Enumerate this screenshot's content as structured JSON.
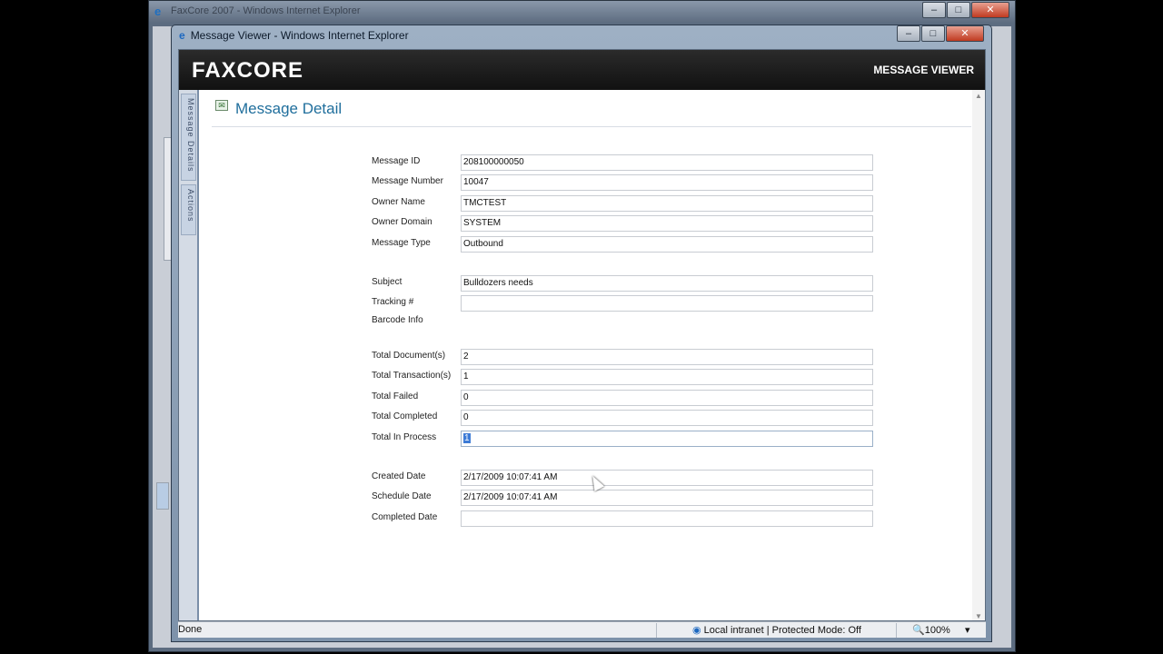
{
  "back_window": {
    "title": "FaxCore 2007 - Windows Internet Explorer"
  },
  "window": {
    "title": "Message Viewer - Windows Internet Explorer",
    "buttons": {
      "minimize": "–",
      "maximize": "□",
      "close": "✕"
    }
  },
  "header": {
    "logo": "FAXCORE",
    "section": "MESSAGE VIEWER"
  },
  "side_tabs": [
    "Message Details",
    "Actions"
  ],
  "detail": {
    "title": "Message Detail"
  },
  "fields": {
    "message_id": {
      "label": "Message ID",
      "value": "208100000050"
    },
    "message_number": {
      "label": "Message Number",
      "value": "10047"
    },
    "owner_name": {
      "label": "Owner Name",
      "value": "TMCTEST"
    },
    "owner_domain": {
      "label": "Owner Domain",
      "value": "SYSTEM"
    },
    "message_type": {
      "label": "Message Type",
      "value": "Outbound"
    },
    "subject": {
      "label": "Subject",
      "value": "Bulldozers needs"
    },
    "tracking": {
      "label": "Tracking #",
      "value": ""
    },
    "barcode": {
      "label": "Barcode Info"
    },
    "total_documents": {
      "label": "Total Document(s)",
      "value": "2"
    },
    "total_transactions": {
      "label": "Total Transaction(s)",
      "value": "1"
    },
    "total_failed": {
      "label": "Total Failed",
      "value": "0"
    },
    "total_completed": {
      "label": "Total Completed",
      "value": "0"
    },
    "total_in_process": {
      "label": "Total In Process",
      "value": "1"
    },
    "created_date": {
      "label": "Created Date",
      "value": "2/17/2009 10:07:41 AM"
    },
    "schedule_date": {
      "label": "Schedule Date",
      "value": "2/17/2009 10:07:41 AM"
    },
    "completed_date": {
      "label": "Completed Date",
      "value": ""
    }
  },
  "status_bar": {
    "status": "Done",
    "zone": "Local intranet | Protected Mode: Off",
    "zoom": "100%",
    "zoom_arrow": "▾"
  }
}
